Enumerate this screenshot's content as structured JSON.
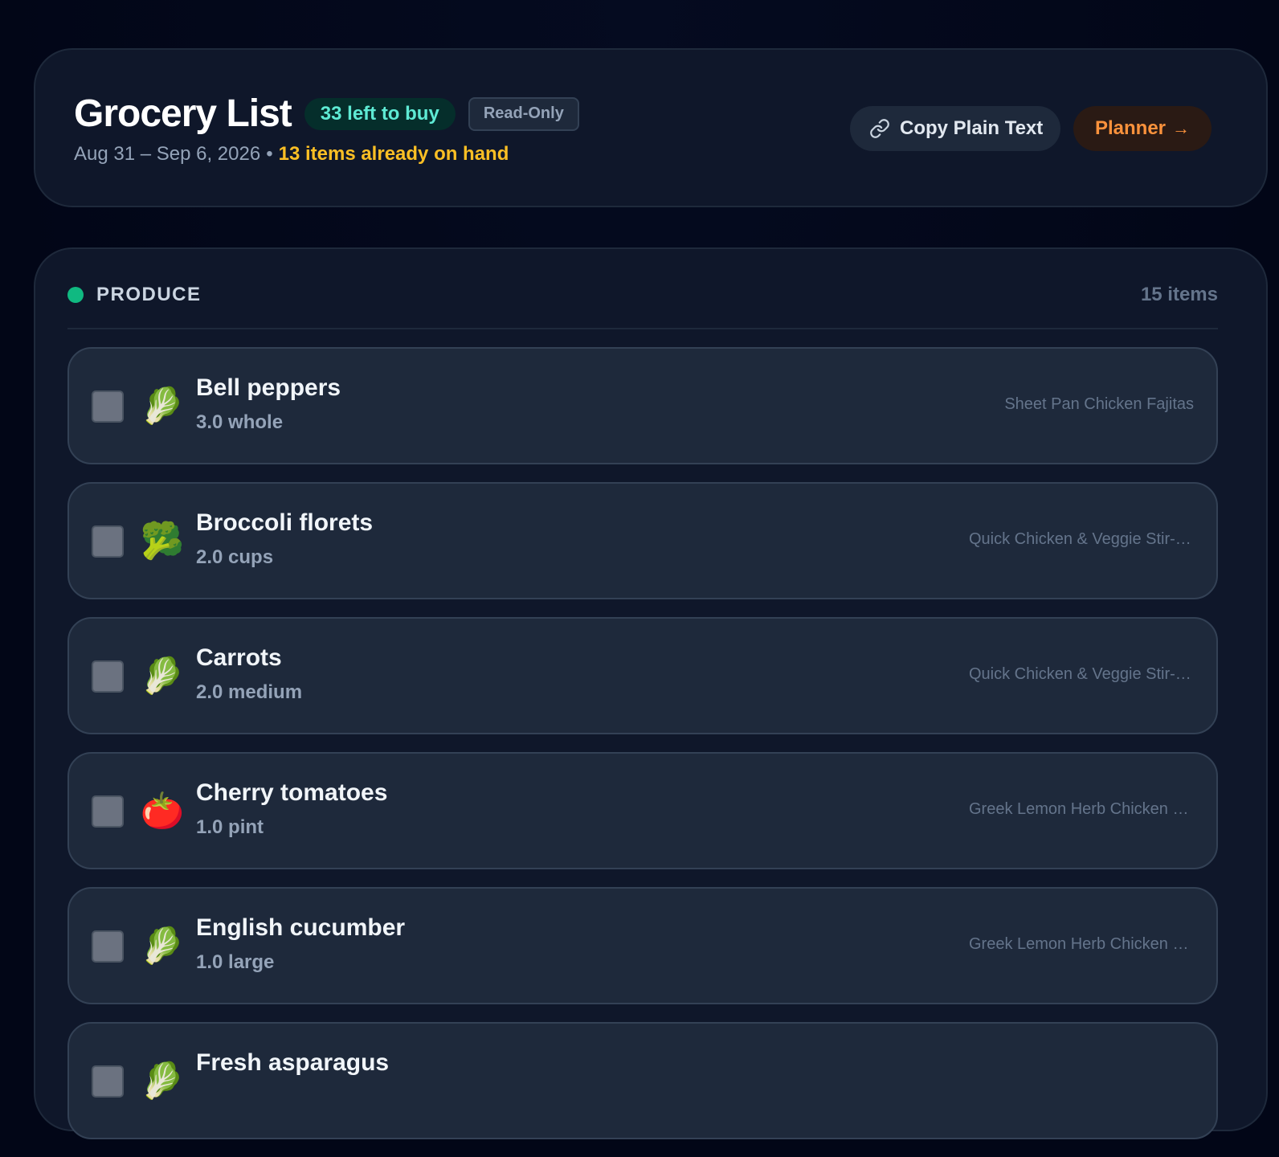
{
  "header": {
    "title": "Grocery List",
    "left_to_buy": "33 left to buy",
    "mode_badge": "Read-Only",
    "date_range": "Aug 31 – Sep 6, 2026",
    "separator": "•",
    "on_hand": "13 items already on hand",
    "copy_label": "Copy Plain Text",
    "planner_label": "Planner",
    "planner_arrow": "→"
  },
  "section": {
    "name": "PRODUCE",
    "count": "15 items",
    "accent": "#10b981",
    "items": [
      {
        "icon": "🥬",
        "icon_name": "leafy-green-icon",
        "name": "Bell peppers",
        "qty": "3.0 whole",
        "recipe": "Sheet Pan Chicken Fajitas",
        "checked": false
      },
      {
        "icon": "🥦",
        "icon_name": "broccoli-icon",
        "name": "Broccoli florets",
        "qty": "2.0 cups",
        "recipe": "Quick Chicken & Veggie Stir-Fry",
        "checked": false
      },
      {
        "icon": "🥬",
        "icon_name": "leafy-green-icon",
        "name": "Carrots",
        "qty": "2.0 medium",
        "recipe": "Quick Chicken & Veggie Stir-Fry",
        "checked": false
      },
      {
        "icon": "🍅",
        "icon_name": "tomato-icon",
        "name": "Cherry tomatoes",
        "qty": "1.0 pint",
        "recipe": "Greek Lemon Herb Chicken Bowls",
        "checked": false
      },
      {
        "icon": "🥬",
        "icon_name": "leafy-green-icon",
        "name": "English cucumber",
        "qty": "1.0 large",
        "recipe": "Greek Lemon Herb Chicken Bowls",
        "checked": false
      },
      {
        "icon": "🥬",
        "icon_name": "leafy-green-icon",
        "name": "Fresh asparagus",
        "qty": "",
        "recipe": "",
        "checked": false
      }
    ]
  },
  "colors": {
    "background": "#020617",
    "card": "#0f172a",
    "item": "#1e293b",
    "left_badge_text": "#5eead4",
    "on_hand_text": "#fbbf24",
    "planner_text": "#fb923c"
  }
}
